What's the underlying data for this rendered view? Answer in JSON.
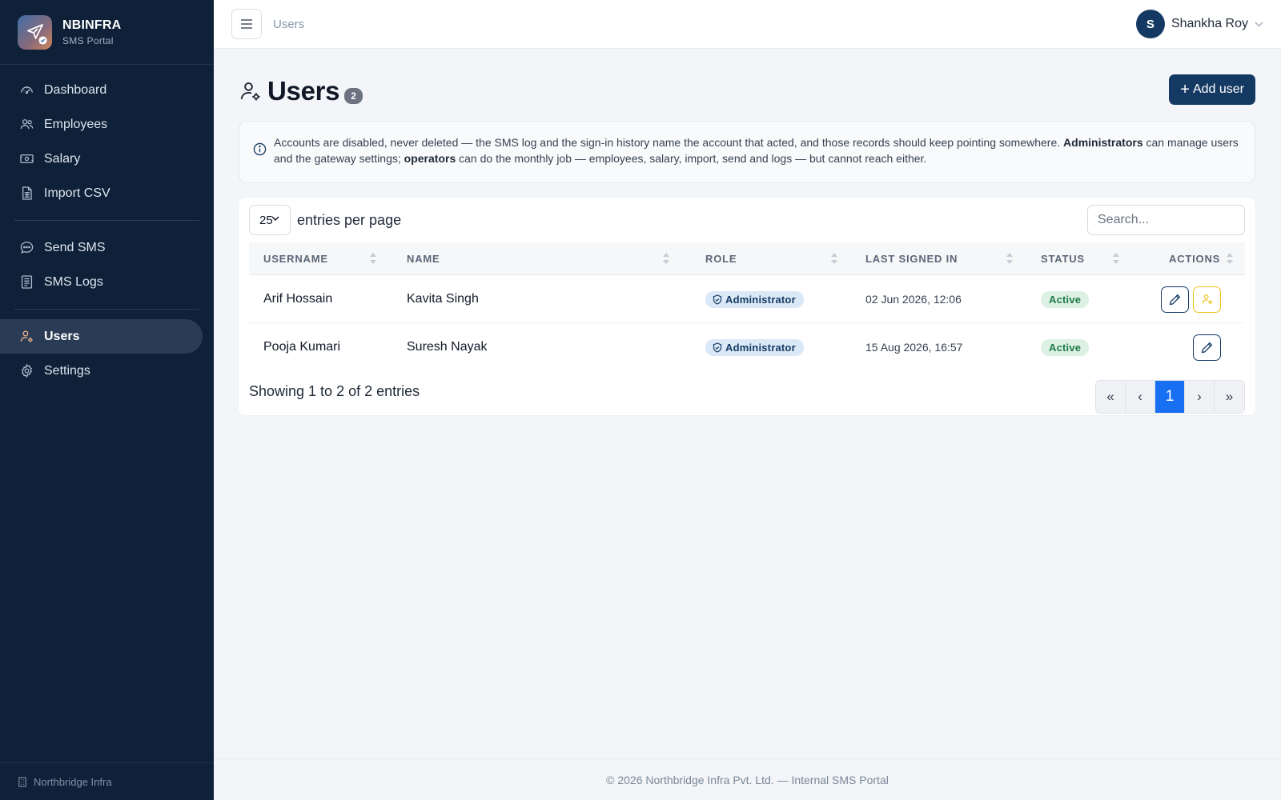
{
  "brand": {
    "name": "NBINFRA",
    "subtitle": "SMS Portal"
  },
  "sidebar": {
    "items": [
      {
        "label": "Dashboard",
        "icon": "dashboard-gauge-icon"
      },
      {
        "label": "Employees",
        "icon": "people-icon"
      },
      {
        "label": "Salary",
        "icon": "cash-icon"
      },
      {
        "label": "Import CSV",
        "icon": "spreadsheet-icon"
      },
      {
        "label": "Send SMS",
        "icon": "chat-dots-icon"
      },
      {
        "label": "SMS Logs",
        "icon": "receipt-list-icon"
      },
      {
        "label": "Users",
        "icon": "person-gear-icon",
        "active": true
      },
      {
        "label": "Settings",
        "icon": "gear-icon"
      }
    ],
    "footer": "Northbridge Infra"
  },
  "topbar": {
    "breadcrumb": "Users",
    "user": {
      "initial": "S",
      "name": "Shankha Roy"
    }
  },
  "page": {
    "title": "Users",
    "count": "2",
    "add_button": "Add user"
  },
  "info": {
    "part1": "Accounts are disabled, never deleted — the SMS log and the sign-in history name the account that acted, and those records should keep pointing somewhere. ",
    "bold1": "Administrators",
    "part2": " can manage users and the gateway settings; ",
    "bold2": "operators",
    "part3": " can do the monthly job — employees, salary, import, send and logs — but cannot reach either."
  },
  "table_controls": {
    "per_page_value": "25",
    "per_page_label": "entries per page",
    "search_placeholder": "Search..."
  },
  "table": {
    "columns": [
      "USERNAME",
      "NAME",
      "ROLE",
      "LAST SIGNED IN",
      "STATUS",
      "ACTIONS"
    ],
    "rows": [
      {
        "username": "Arif Hossain",
        "name": "Kavita Singh",
        "role": "Administrator",
        "last_signed_in": "02 Jun 2026, 12:06",
        "status": "Active"
      },
      {
        "username": "Pooja Kumari",
        "name": "Suresh Nayak",
        "role": "Administrator",
        "last_signed_in": "15 Aug 2026, 16:57",
        "status": "Active"
      }
    ]
  },
  "pagination": {
    "summary": "Showing 1 to 2 of 2 entries",
    "first": "«",
    "prev": "‹",
    "current": "1",
    "next": "›",
    "last": "»"
  },
  "footer": "© 2026 Northbridge Infra Pvt. Ltd. — Internal SMS Portal",
  "colors": {
    "sidebar_bg": "#0f2138",
    "primary": "#143a63",
    "active_page": "#1770f2",
    "status_green": "#1e7b47",
    "warning_yellow": "#f2c21b"
  }
}
